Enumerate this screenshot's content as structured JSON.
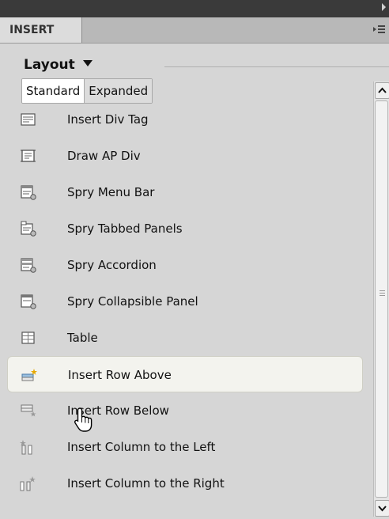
{
  "panel": {
    "tab_label": "INSERT",
    "category": "Layout",
    "modes": [
      "Standard",
      "Expanded"
    ],
    "active_mode": "Standard"
  },
  "items": [
    {
      "label": "Insert Div Tag",
      "icon": "div-tag-icon"
    },
    {
      "label": "Draw AP Div",
      "icon": "ap-div-icon"
    },
    {
      "label": "Spry Menu Bar",
      "icon": "spry-menu-bar-icon"
    },
    {
      "label": "Spry Tabbed Panels",
      "icon": "spry-tabbed-panels-icon"
    },
    {
      "label": "Spry Accordion",
      "icon": "spry-accordion-icon"
    },
    {
      "label": "Spry Collapsible Panel",
      "icon": "spry-collapsible-panel-icon"
    },
    {
      "label": "Table",
      "icon": "table-icon"
    },
    {
      "label": "Insert Row Above",
      "icon": "insert-row-above-icon"
    },
    {
      "label": "Insert Row Below",
      "icon": "insert-row-below-icon"
    },
    {
      "label": "Insert Column to the Left",
      "icon": "insert-column-left-icon"
    },
    {
      "label": "Insert Column to the Right",
      "icon": "insert-column-right-icon"
    }
  ],
  "highlighted_item": "Insert Row Above",
  "colors": {
    "panel_bg": "#d6d6d6",
    "titlebar": "#3a3a3a",
    "highlight_bg": "#f3f3ee",
    "icon_accent": "#e6a800"
  }
}
